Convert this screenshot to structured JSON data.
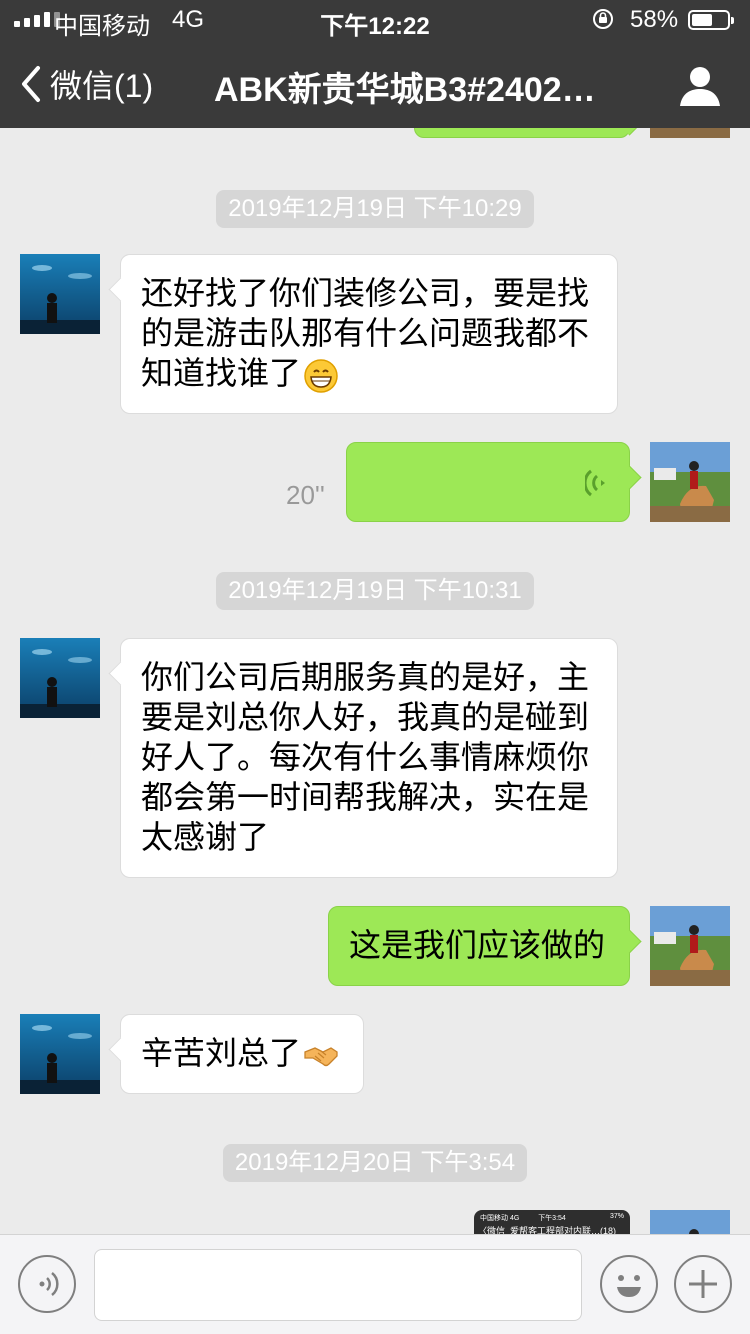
{
  "status_bar": {
    "carrier": "中国移动",
    "network": "4G",
    "time": "下午12:22",
    "battery_percent": "58%",
    "battery_level": 0.58
  },
  "nav": {
    "back_label": "微信(1)",
    "title": "ABK新贵华城B3#2402…",
    "profile_icon": "person-icon"
  },
  "messages": {
    "ts1": "2019年12月19日 下午10:29",
    "msg1": "还好找了你们装修公司，要是找的是游击队那有什么问题我都不知道找谁了",
    "voice_duration": "20''",
    "ts2": "2019年12月19日 下午10:31",
    "msg2": "你们公司后期服务真的是好，主要是刘总你人好，我真的是碰到好人了。每次有什么事情麻烦你都会第一时间帮我解决，实在是太感谢了",
    "msg3": "这是我们应该做的",
    "msg4": "辛苦刘总了",
    "ts3": "2019年12月20日 下午3:54",
    "thumb_title": "爱帮客工程部对内联…(18)",
    "thumb_back": "〈微信",
    "thumb_carrier": "中国移动",
    "thumb_net": "4G",
    "thumb_time": "下午3:54",
    "thumb_batt": "37%"
  },
  "colors": {
    "nav_bg": "#3a3a3a",
    "chat_bg": "#ebebeb",
    "outgoing_bubble": "#9de856",
    "incoming_bubble": "#ffffff",
    "timestamp_bg": "#d6d6d6"
  },
  "icons": {
    "grin_emoji": "grinning-face-icon",
    "handshake_emoji": "handshake-icon",
    "voice_wave": "voice-wave-icon",
    "voice_toggle": "voice-input-icon",
    "emoji_button": "emoji-icon",
    "plus_button": "plus-icon"
  }
}
